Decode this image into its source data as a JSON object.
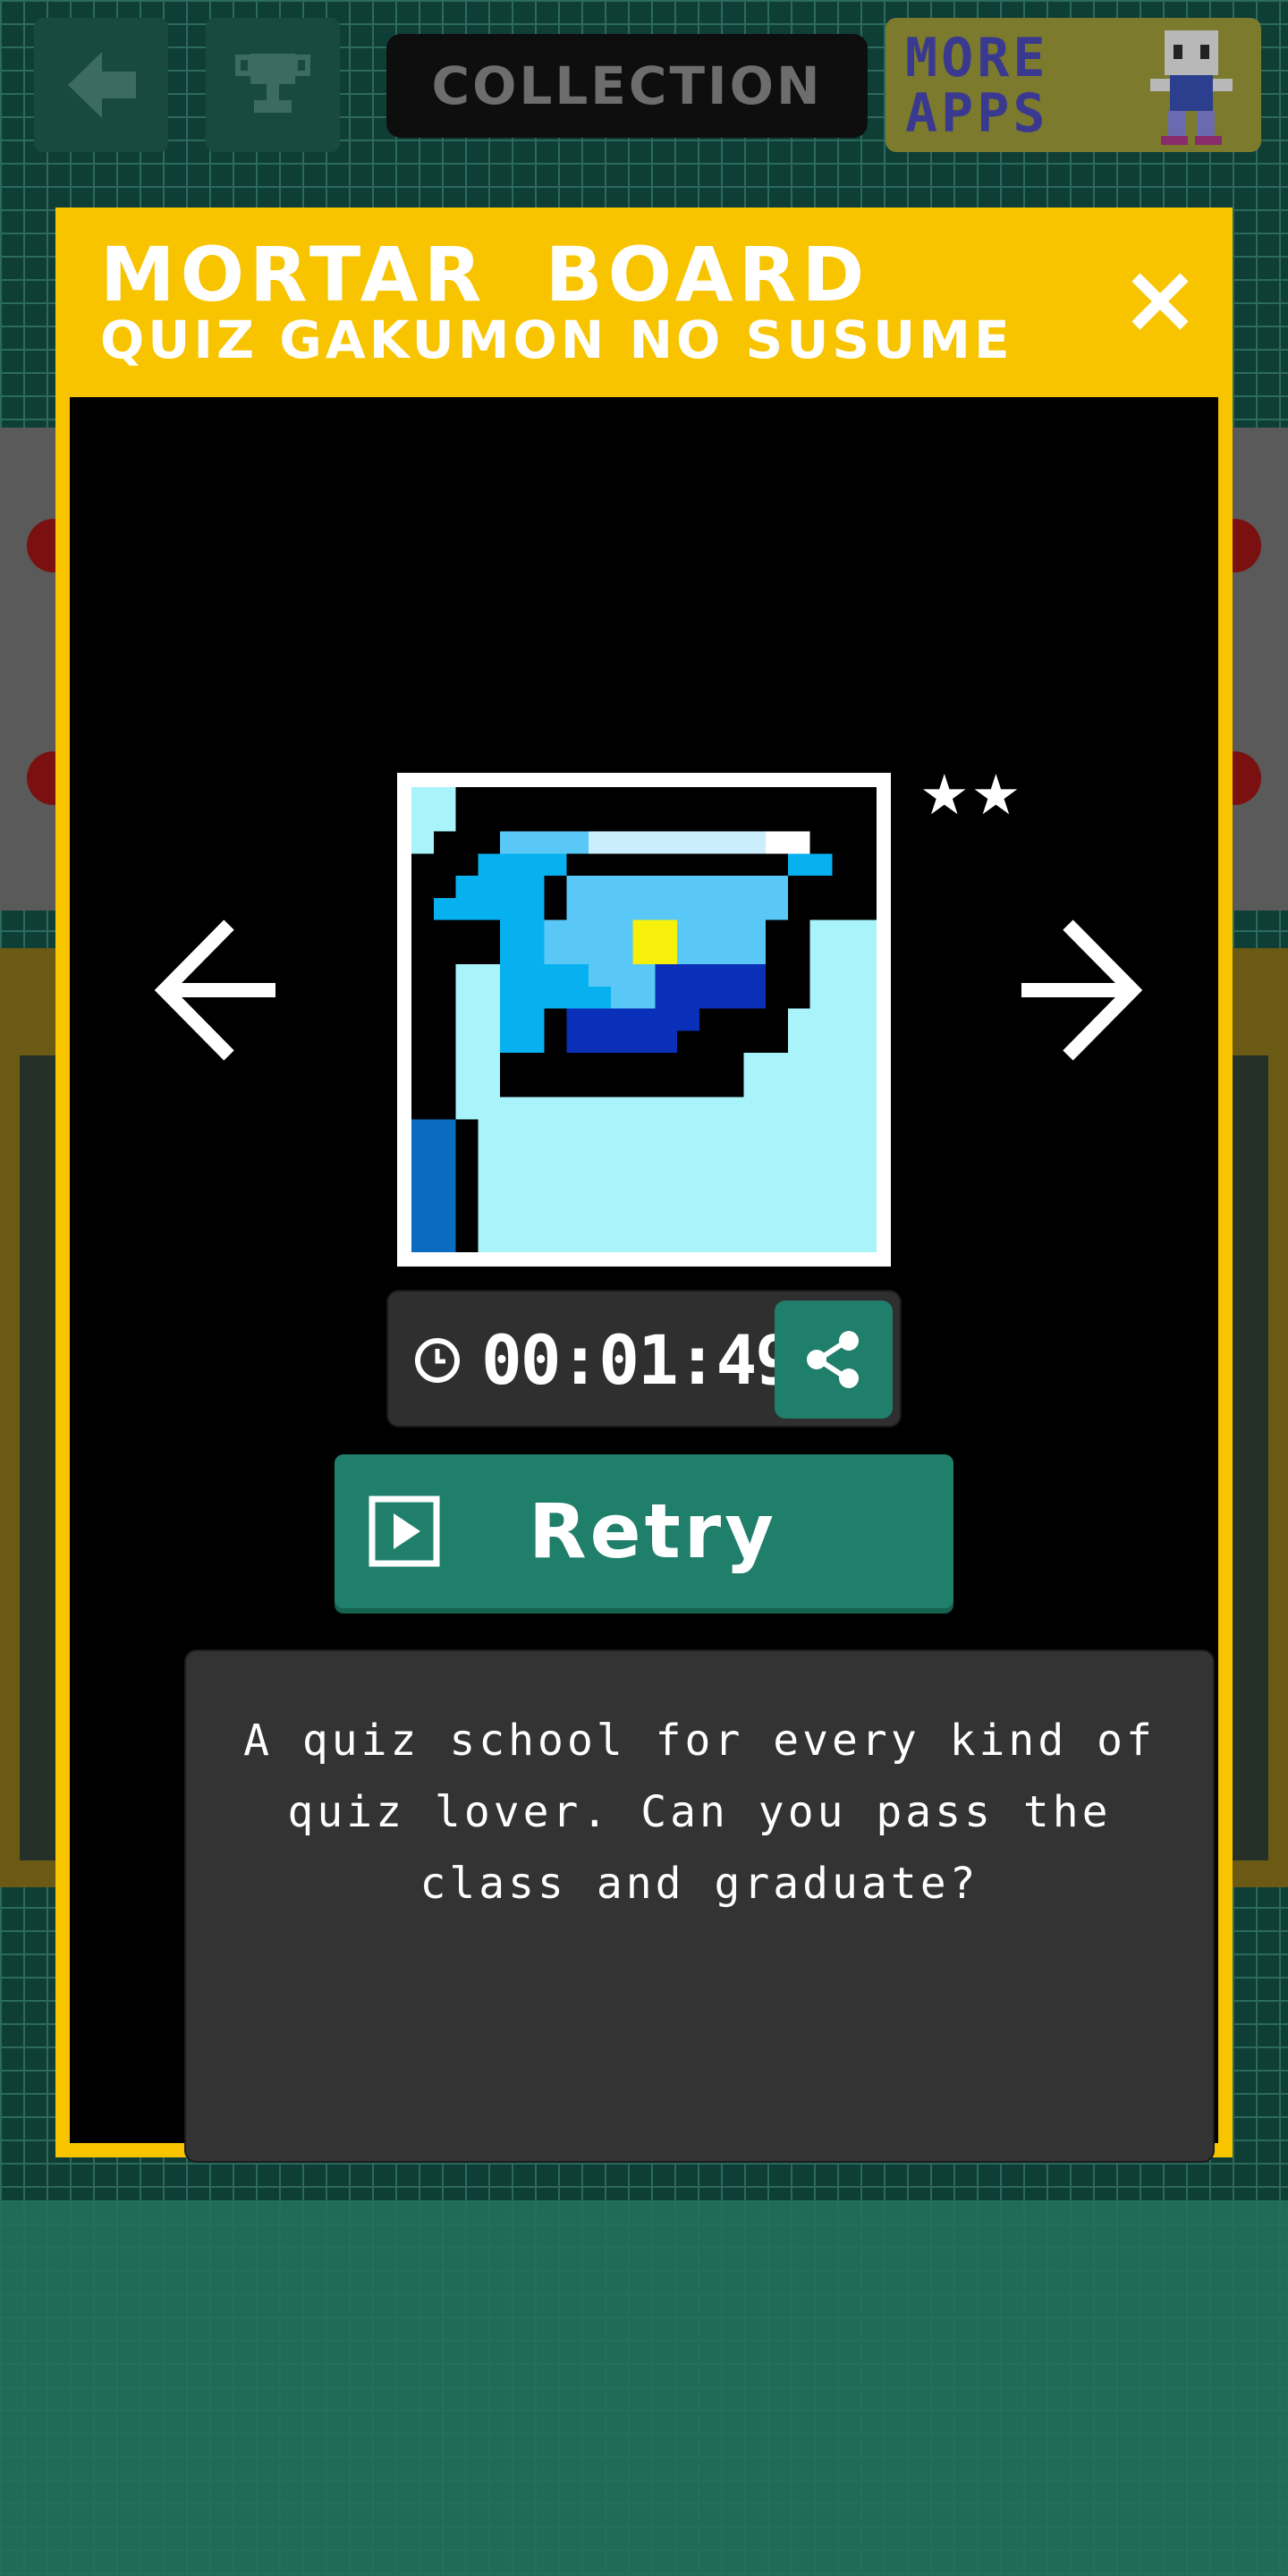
{
  "topbar": {
    "collection_label": "COLLECTION",
    "more_apps_text": "MORE APPS"
  },
  "modal": {
    "title": "MORTAR BOARD",
    "subtitle": "QUIZ GAKUMON NO SUSUME",
    "stars": "★★",
    "time": "00:01:49",
    "retry_label": "Retry",
    "description": "A quiz school for every kind of quiz lover. Can you pass the class and graduate?"
  },
  "pixel_art": {
    "palette": {
      "K": "#000000",
      "L": "#a9f3fb",
      "M": "#5ac8f6",
      "C": "#07b0ef",
      "P": "#caeefb",
      "W": "#ffffff",
      "D": "#0a2fb8",
      "Y": "#f6f00a",
      "B": "#0a6cbf"
    },
    "rows": [
      "LLKKKKKKKKKKKKKKKKKKK",
      "LLKKKKKKKKKKKKKKKKKKK",
      "LKKKMMMMPPPPPPPPWWKKK",
      "KKKCCCCKKKKKKKKKKCCKK",
      "KKCCCCKMMMMMMMMMMKKKK",
      "KCCCCCKMMMMMMMMMMKKKK",
      "KKKKCCMMMMYYMMMMKKLLL",
      "KKKKCCMMMMYYMMMMKKLLL",
      "KKLLCCCCMMMDDDDDKKLLL",
      "KKLLCCCCCMMDDDDDKKLLL",
      "KKLLCCKDDDDDDKKKKLLLL",
      "KKLLCCKDDDDDKKKKKLLLL",
      "KKLLKKKKKKKKKKKLLLLLL",
      "KKLLKKKKKKKKKKKLLLLLL",
      "KKLLLLLLLLLLLLLLLLLLL",
      "BBKLLLLLLLLLLLLLLLLLL",
      "BBKLLLLLLLLLLLLLLLLLL",
      "BBKLLLLLLLLLLLLLLLLLL",
      "BBKLLLLLLLLLLLLLLLLLL",
      "BBKLLLLLLLLLLLLLLLLLL",
      "BBKLLLLLLLLLLLLLLLLLL"
    ]
  }
}
